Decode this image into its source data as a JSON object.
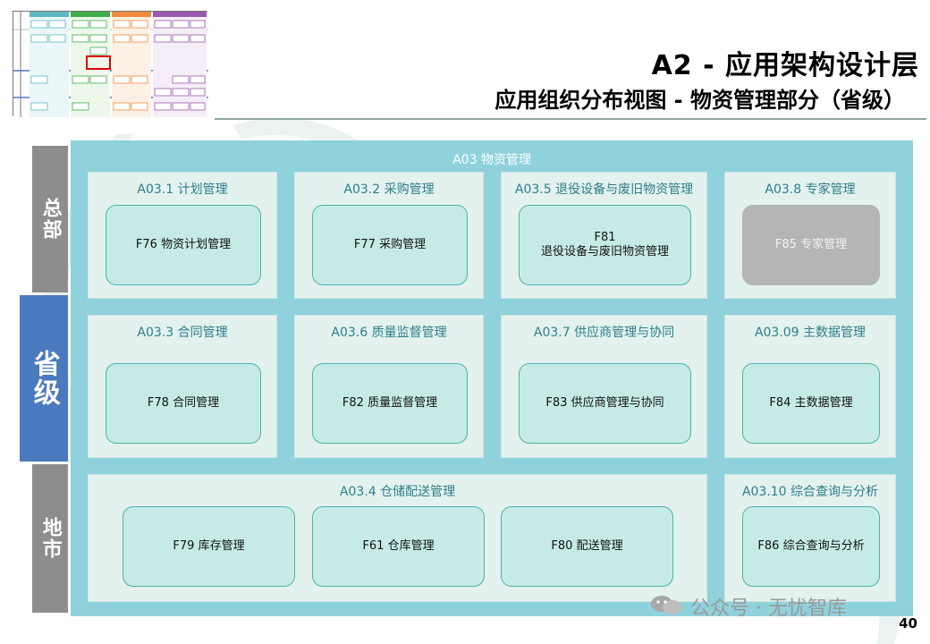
{
  "header": {
    "title": "A2 - 应用架构设计层",
    "subtitle": "应用组织分布视图 - 物资管理部分（省级）"
  },
  "levels": {
    "hq": "总部",
    "province": "省级",
    "local": "地市"
  },
  "domain": {
    "label": "A03 物资管理"
  },
  "groups": {
    "g1": {
      "label": "A03.1 计划管理",
      "funcs": [
        "F76 物资计划管理"
      ]
    },
    "g2": {
      "label": "A03.2 采购管理",
      "funcs": [
        "F77 采购管理"
      ]
    },
    "g5": {
      "label": "A03.5 退役设备与废旧物资管理",
      "func_line1": "F81",
      "func_line2": "退役设备与废旧物资管理"
    },
    "g8": {
      "label": "A03.8 专家管理",
      "funcs": [
        "F85 专家管理"
      ]
    },
    "g3": {
      "label": "A03.3 合同管理",
      "funcs": [
        "F78 合同管理"
      ]
    },
    "g6": {
      "label": "A03.6 质量监督管理",
      "funcs": [
        "F82 质量监督管理"
      ]
    },
    "g7": {
      "label": "A03.7 供应商管理与协同",
      "funcs": [
        "F83 供应商管理与协同"
      ]
    },
    "g9": {
      "label": "A03.09 主数据管理",
      "funcs": [
        "F84 主数据管理"
      ]
    },
    "g4": {
      "label": "A03.4 仓储配送管理",
      "funcs": [
        "F79 库存管理",
        "F61 仓库管理",
        "F80 配送管理"
      ]
    },
    "g10": {
      "label": "A03.10 综合查询与分析",
      "funcs": [
        "F86 综合查询与分析"
      ]
    }
  },
  "watermark": "公众号 · 无忧智库",
  "page_number": "40",
  "colors": {
    "domain_bg": "#8fd2dc",
    "group_bg": "#e3f2ee",
    "func_bg": "#c6ebe6",
    "func_border": "#4bb3aa",
    "province_blue": "#4b79bd",
    "level_gray": "#8d8d8d",
    "disabled_gray": "#b5b5b5"
  }
}
